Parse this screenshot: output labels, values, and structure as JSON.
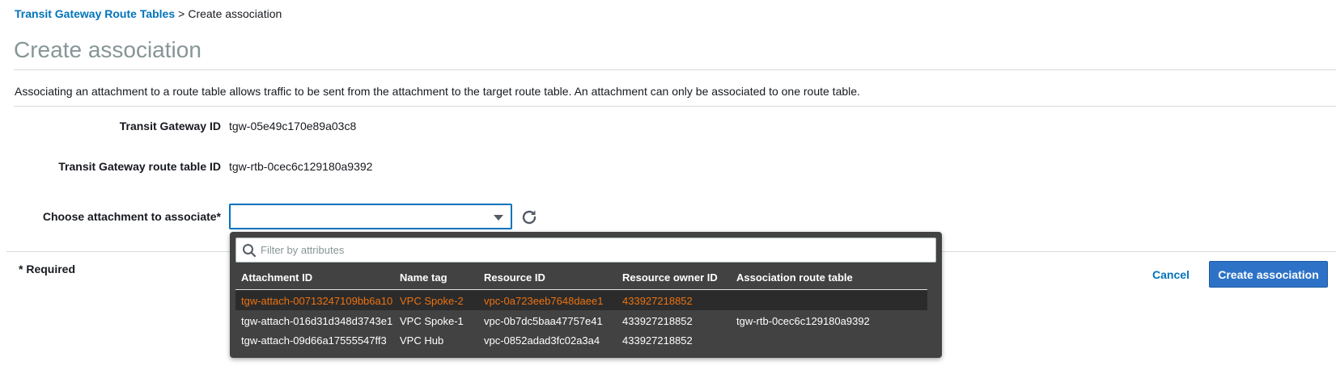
{
  "breadcrumb": {
    "parent": "Transit Gateway Route Tables",
    "separator": ">",
    "current": "Create association"
  },
  "page_title": "Create association",
  "description": "Associating an attachment to a route table allows traffic to be sent from the attachment to the target route table. An attachment can only be associated to one route table.",
  "fields": {
    "tgw_id": {
      "label": "Transit Gateway ID",
      "value": "tgw-05e49c170e89a03c8"
    },
    "tgw_rtb_id": {
      "label": "Transit Gateway route table ID",
      "value": "tgw-rtb-0cec6c129180a9392"
    },
    "attachment": {
      "label": "Choose attachment to associate*",
      "value": ""
    }
  },
  "required_note": "* Required",
  "buttons": {
    "cancel": "Cancel",
    "create": "Create association"
  },
  "dropdown": {
    "filter_placeholder": "Filter by attributes",
    "columns": [
      "Attachment ID",
      "Name tag",
      "Resource ID",
      "Resource owner ID",
      "Association route table"
    ],
    "rows": [
      [
        "tgw-attach-00713247109bb6a10",
        "VPC Spoke-2",
        "vpc-0a723eeb7648daee1",
        "433927218852",
        ""
      ],
      [
        "tgw-attach-016d31d348d3743e1",
        "VPC Spoke-1",
        "vpc-0b7dc5baa47757e41",
        "433927218852",
        "tgw-rtb-0cec6c129180a9392"
      ],
      [
        "tgw-attach-09d66a17555547ff3",
        "VPC Hub",
        "vpc-0852adad3fc02a3a4",
        "433927218852",
        ""
      ]
    ]
  },
  "colors": {
    "link": "#0073bb",
    "primary_button": "#2d72c7",
    "highlight_text": "#ec7211",
    "dropdown_bg": "#424242"
  },
  "icons": {
    "refresh": "refresh-icon",
    "search": "search-icon",
    "caret": "caret-down-icon"
  }
}
